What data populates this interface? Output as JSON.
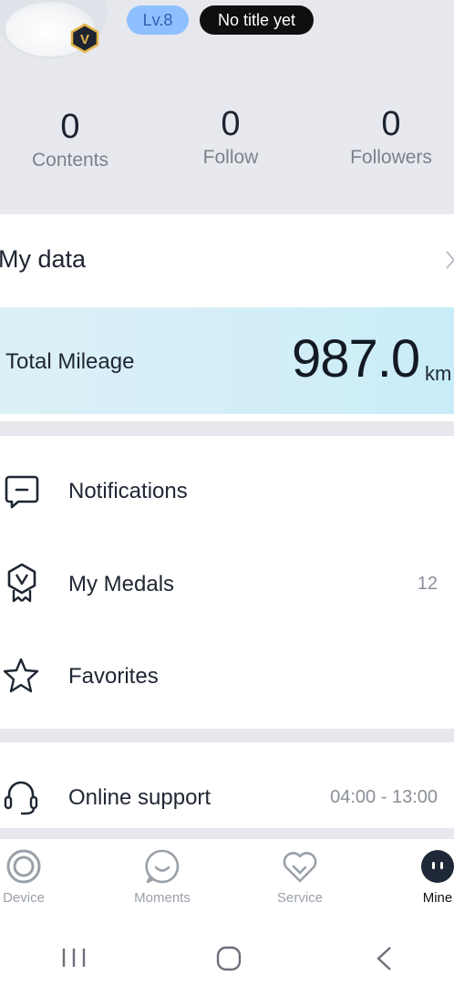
{
  "profile": {
    "level": "Lv.8",
    "title": "No title yet",
    "vip_badge_letter": "V"
  },
  "stats": [
    {
      "value": "0",
      "label": "Contents"
    },
    {
      "value": "0",
      "label": "Follow"
    },
    {
      "value": "0",
      "label": "Followers"
    }
  ],
  "my_data": {
    "title": "My data",
    "mileage_label": "Total Mileage",
    "mileage_value": "987.0",
    "mileage_unit": "km"
  },
  "menu": [
    {
      "label": "Notifications",
      "icon": "notification-icon",
      "value": ""
    },
    {
      "label": "My Medals",
      "icon": "medal-icon",
      "value": "12"
    },
    {
      "label": "Favorites",
      "icon": "star-icon",
      "value": ""
    }
  ],
  "support": {
    "label": "Online support",
    "icon": "headset-icon",
    "hours": "04:00 - 13:00"
  },
  "tabs": [
    {
      "label": "Device",
      "icon": "device-icon",
      "active": false
    },
    {
      "label": "Moments",
      "icon": "moments-icon",
      "active": false
    },
    {
      "label": "Service",
      "icon": "service-icon",
      "active": false
    },
    {
      "label": "Mine",
      "icon": "mine-icon",
      "active": true
    }
  ],
  "colors": {
    "level_pill": "#8ec0ff",
    "title_pill": "#0f0f10",
    "mileage_gradient": "#d3eef8",
    "vip_badge": "#1f2430",
    "vip_gold": "#e3b64a"
  }
}
